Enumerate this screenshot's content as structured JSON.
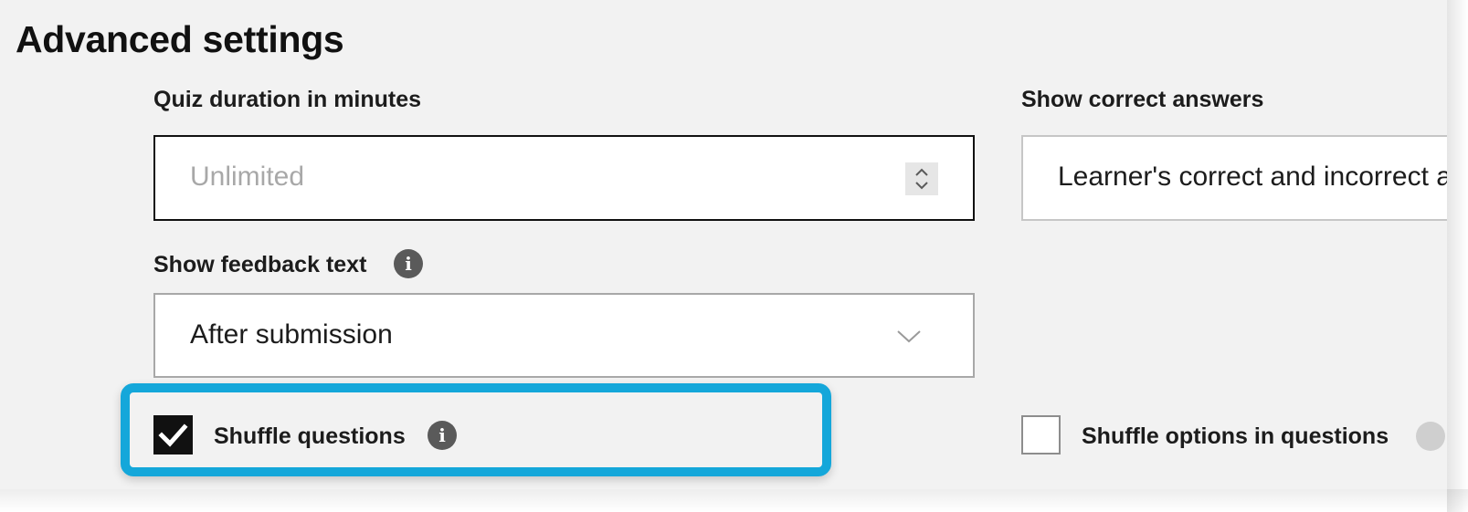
{
  "page": {
    "title": "Advanced settings"
  },
  "quiz_duration": {
    "label": "Quiz duration in minutes",
    "placeholder": "Unlimited",
    "value": ""
  },
  "show_correct_answers": {
    "label": "Show correct answers",
    "selected_value": "Learner's correct and incorrect answers"
  },
  "show_feedback_text": {
    "label": "Show feedback text",
    "selected_value": "After submission"
  },
  "shuffle_questions": {
    "label": "Shuffle questions",
    "checked": true
  },
  "shuffle_options": {
    "label": "Shuffle options in questions",
    "checked": false
  },
  "icons": {
    "info": "i",
    "stepper": "stepper-icon",
    "chevron": "chevron-down-icon",
    "check": "checkmark-icon"
  },
  "colors": {
    "highlight": "#14a7da",
    "panel_background": "#f2f2f2",
    "checkbox_checked": "#111111",
    "info_icon": "#5a5a5a"
  }
}
